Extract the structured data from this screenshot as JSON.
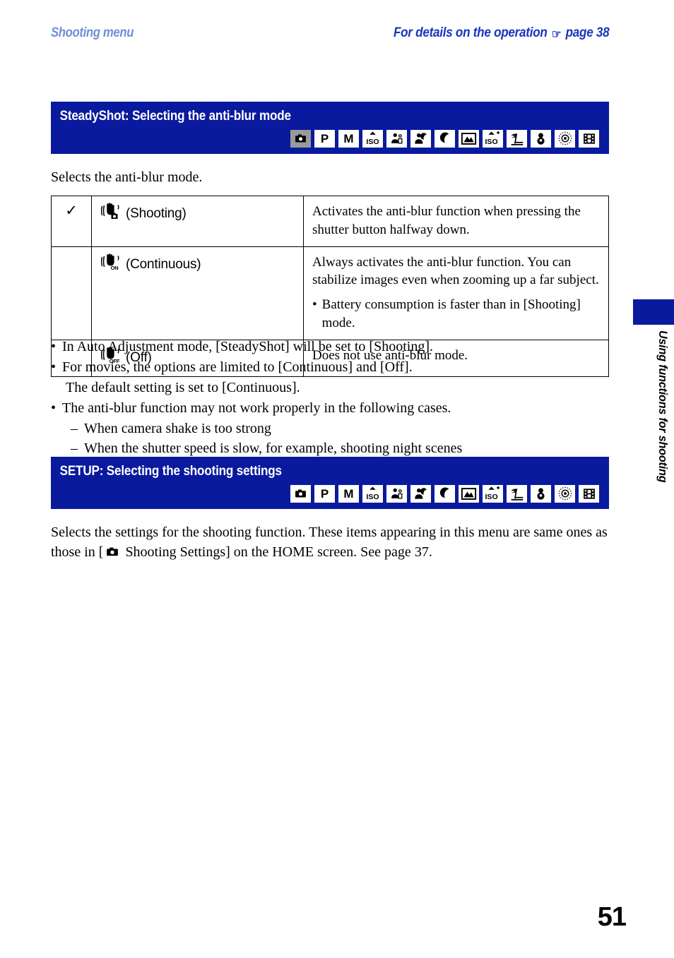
{
  "running_head": {
    "left": "Shooting menu",
    "right_text": "For details on the operation",
    "right_icon": "pointing-hand-icon",
    "right_page_ref": "page 38"
  },
  "colors": {
    "banner_blue": "#0a1a9e",
    "head_left_blue": "#6f8fd6",
    "head_right_blue": "#1b34bd",
    "active_icon_gray": "#9a9a9a"
  },
  "mode_icons": [
    {
      "name": "still-camera-icon",
      "glyph": "camera",
      "active": true
    },
    {
      "name": "program-auto-icon",
      "glyph": "P",
      "active": false
    },
    {
      "name": "manual-mode-icon",
      "glyph": "M",
      "active": false
    },
    {
      "name": "high-sensitivity-icon",
      "glyph": "ISO",
      "active": false
    },
    {
      "name": "soft-snap-icon",
      "glyph": "soft-snap",
      "active": false
    },
    {
      "name": "twilight-portrait-icon",
      "glyph": "twilight-portrait",
      "active": false
    },
    {
      "name": "twilight-icon",
      "glyph": "moon",
      "active": false
    },
    {
      "name": "landscape-icon",
      "glyph": "landscape",
      "active": false
    },
    {
      "name": "high-sensitivity-plus-icon",
      "glyph": "ISO+",
      "active": false
    },
    {
      "name": "beach-icon",
      "glyph": "beach",
      "active": false
    },
    {
      "name": "snow-icon",
      "glyph": "snowman",
      "active": false
    },
    {
      "name": "fireworks-icon",
      "glyph": "fireworks",
      "active": false
    },
    {
      "name": "movie-mode-icon",
      "glyph": "film",
      "active": false
    }
  ],
  "section_steadyshot": {
    "banner_title": "SteadyShot: Selecting the anti-blur mode",
    "intro": "Selects the anti-blur mode.",
    "options": [
      {
        "checked": true,
        "check_glyph": "✓",
        "icon": "hand-shake-shooting-icon",
        "icon_badge": "camera",
        "label": "(Shooting)",
        "description": "Activates the anti-blur function when pressing the shutter button halfway down.",
        "sub_bullets": []
      },
      {
        "checked": false,
        "check_glyph": "",
        "icon": "hand-shake-continuous-icon",
        "icon_badge": "ON",
        "label": "(Continuous)",
        "description": "Always activates the anti-blur function. You can stabilize images even when zooming up a far subject.",
        "sub_bullets": [
          "Battery consumption is faster than in [Shooting] mode."
        ]
      },
      {
        "checked": false,
        "check_glyph": "",
        "icon": "hand-shake-off-icon",
        "icon_badge": "OFF",
        "label": "(Off)",
        "description": "Does not use anti-blur mode.",
        "sub_bullets": []
      }
    ],
    "notes": [
      {
        "text": "In Auto Adjustment mode, [SteadyShot] will be set to [Shooting].",
        "continuation": "",
        "sub_items": []
      },
      {
        "text": "For movies, the options are limited to [Continuous] and [Off].",
        "continuation": "The default setting is set to [Continuous].",
        "sub_items": []
      },
      {
        "text": "The anti-blur function may not work properly in the following cases.",
        "continuation": "",
        "sub_items": [
          "When camera shake is too strong",
          "When the shutter speed is slow, for example, shooting night scenes"
        ]
      }
    ]
  },
  "section_setup": {
    "banner_title": "SETUP: Selecting the shooting settings",
    "body_part1": "Selects the settings for the shooting function. These items appearing in this menu are same ones as those in [",
    "body_icon": "still-camera-icon",
    "body_part2": "Shooting Settings] on the HOME screen. See page 37."
  },
  "side_tab": {
    "label": "Using functions for shooting"
  },
  "page_number": "51"
}
